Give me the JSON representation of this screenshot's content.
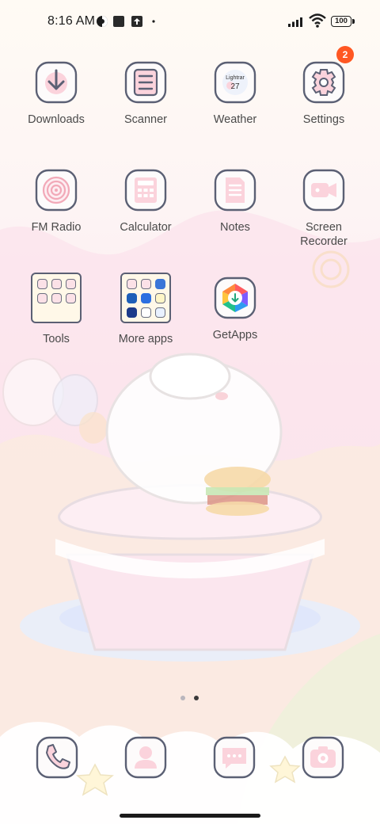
{
  "status_bar": {
    "time": "8:16 AM",
    "battery": "100",
    "left_icons": [
      "vpn-icon",
      "square-notification-icon",
      "upload-notification-icon",
      "dot-icon"
    ],
    "right_icons": [
      "signal-icon",
      "wifi-icon",
      "battery-icon"
    ]
  },
  "apps": [
    {
      "label": "Downloads",
      "icon": "download-arrow-icon"
    },
    {
      "label": "Scanner",
      "icon": "scanner-icon"
    },
    {
      "label": "Weather",
      "icon": "weather-icon",
      "icon_text_line1": "Lightrar",
      "icon_text_line2": "27"
    },
    {
      "label": "Settings",
      "icon": "gear-icon",
      "badge": "2"
    },
    {
      "label": "FM Radio",
      "icon": "radio-icon"
    },
    {
      "label": "Calculator",
      "icon": "calculator-icon"
    },
    {
      "label": "Notes",
      "icon": "notes-icon"
    },
    {
      "label": "Screen Recorder",
      "icon": "video-camera-icon"
    },
    {
      "label": "Tools",
      "icon": "folder-icon"
    },
    {
      "label": "More apps",
      "icon": "folder-icon"
    },
    {
      "label": "GetApps",
      "icon": "getapps-icon"
    }
  ],
  "dock": [
    {
      "name": "phone",
      "icon": "phone-icon"
    },
    {
      "name": "contacts",
      "icon": "contacts-icon"
    },
    {
      "name": "messages",
      "icon": "chat-bubble-icon"
    },
    {
      "name": "camera",
      "icon": "camera-icon"
    }
  ],
  "page_indicator": {
    "current": 2,
    "total": 2
  },
  "colors": {
    "accent_pink": "#f5a9b8",
    "icon_outline": "#5b6074",
    "badge": "#ff5722",
    "label_text": "#4a4a4a"
  }
}
